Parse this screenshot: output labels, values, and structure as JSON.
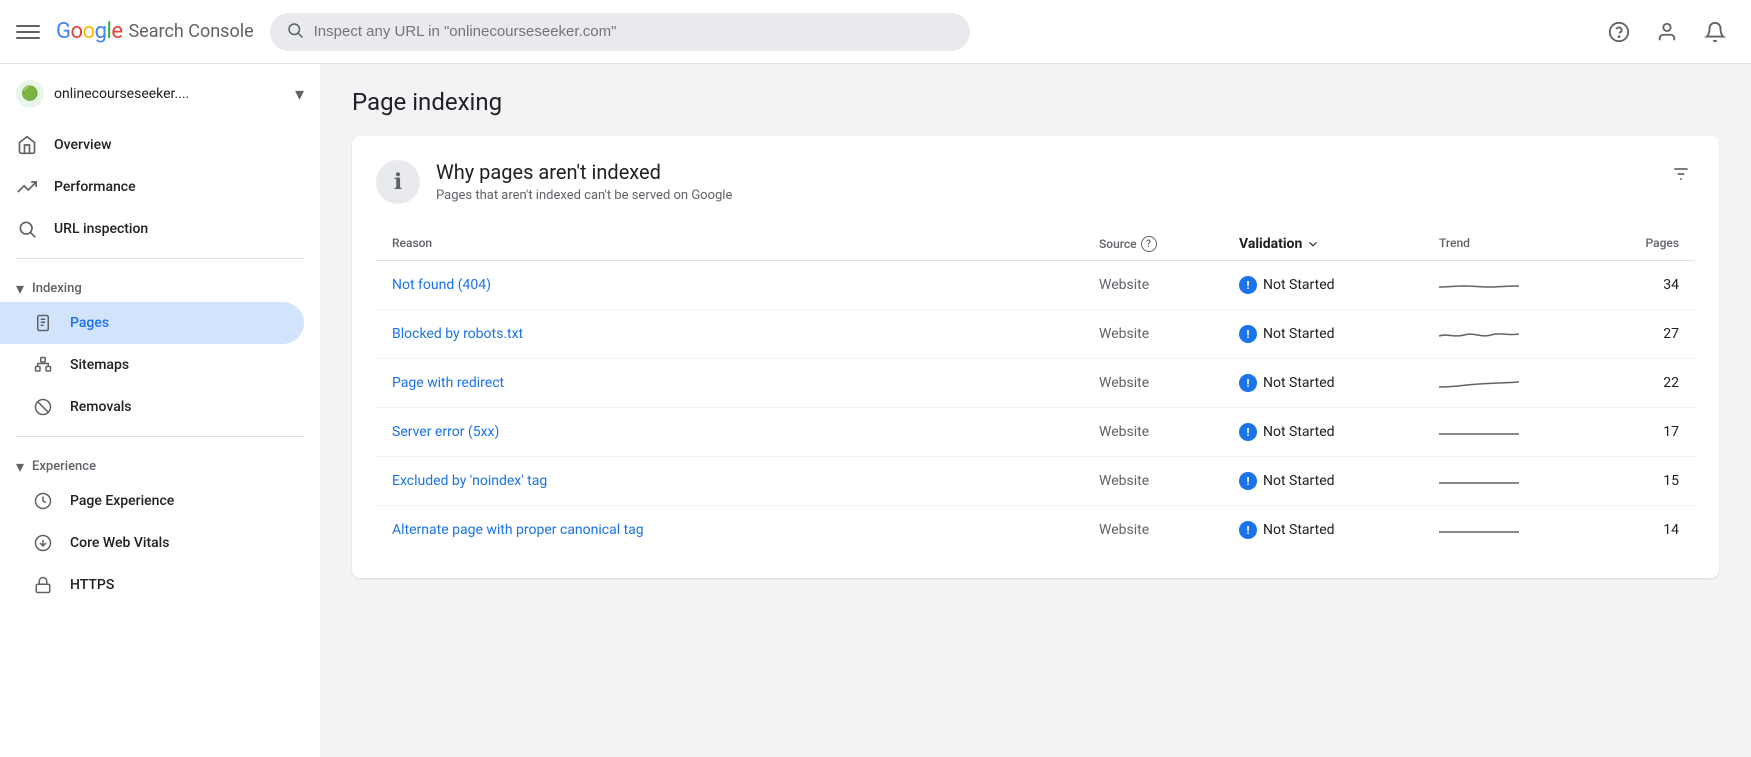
{
  "topbar": {
    "menu_icon": "☰",
    "logo": {
      "google": "Google",
      "product": "Search Console"
    },
    "search_placeholder": "Inspect any URL in \"onlinecourseseeker.com\"",
    "help_icon": "?",
    "account_icon": "👤",
    "notification_icon": "🔔"
  },
  "sidebar": {
    "property": {
      "name": "onlinecourseseeker....",
      "favicon": "🟢"
    },
    "nav_items": [
      {
        "id": "overview",
        "label": "Overview",
        "icon": "home",
        "active": false
      },
      {
        "id": "performance",
        "label": "Performance",
        "icon": "trending_up",
        "active": false
      },
      {
        "id": "url_inspection",
        "label": "URL inspection",
        "icon": "search",
        "active": false
      }
    ],
    "sections": [
      {
        "id": "indexing",
        "label": "Indexing",
        "expanded": true,
        "items": [
          {
            "id": "pages",
            "label": "Pages",
            "icon": "pages",
            "active": true
          },
          {
            "id": "sitemaps",
            "label": "Sitemaps",
            "icon": "sitemap",
            "active": false
          },
          {
            "id": "removals",
            "label": "Removals",
            "icon": "removals",
            "active": false
          }
        ]
      },
      {
        "id": "experience",
        "label": "Experience",
        "expanded": true,
        "items": [
          {
            "id": "page_experience",
            "label": "Page Experience",
            "icon": "experience",
            "active": false
          },
          {
            "id": "core_web_vitals",
            "label": "Core Web Vitals",
            "icon": "vitals",
            "active": false
          },
          {
            "id": "https",
            "label": "HTTPS",
            "icon": "lock",
            "active": false
          }
        ]
      }
    ]
  },
  "page": {
    "title": "Page indexing"
  },
  "card": {
    "icon": "ℹ",
    "heading": "Why pages aren't indexed",
    "subheading": "Pages that aren't indexed can't be served on Google",
    "table": {
      "columns": {
        "reason": "Reason",
        "source": "Source",
        "validation": "Validation",
        "trend": "Trend",
        "pages": "Pages"
      },
      "rows": [
        {
          "reason": "Not found (404)",
          "source": "Website",
          "validation": "Not Started",
          "trend_type": "flat",
          "pages": 34
        },
        {
          "reason": "Blocked by robots.txt",
          "source": "Website",
          "validation": "Not Started",
          "trend_type": "wavy",
          "pages": 27
        },
        {
          "reason": "Page with redirect",
          "source": "Website",
          "validation": "Not Started",
          "trend_type": "slight_up",
          "pages": 22
        },
        {
          "reason": "Server error (5xx)",
          "source": "Website",
          "validation": "Not Started",
          "trend_type": "flat",
          "pages": 17
        },
        {
          "reason": "Excluded by 'noindex' tag",
          "source": "Website",
          "validation": "Not Started",
          "trend_type": "flat",
          "pages": 15
        },
        {
          "reason": "Alternate page with proper canonical tag",
          "source": "Website",
          "validation": "Not Started",
          "trend_type": "flat",
          "pages": 14
        }
      ]
    }
  }
}
